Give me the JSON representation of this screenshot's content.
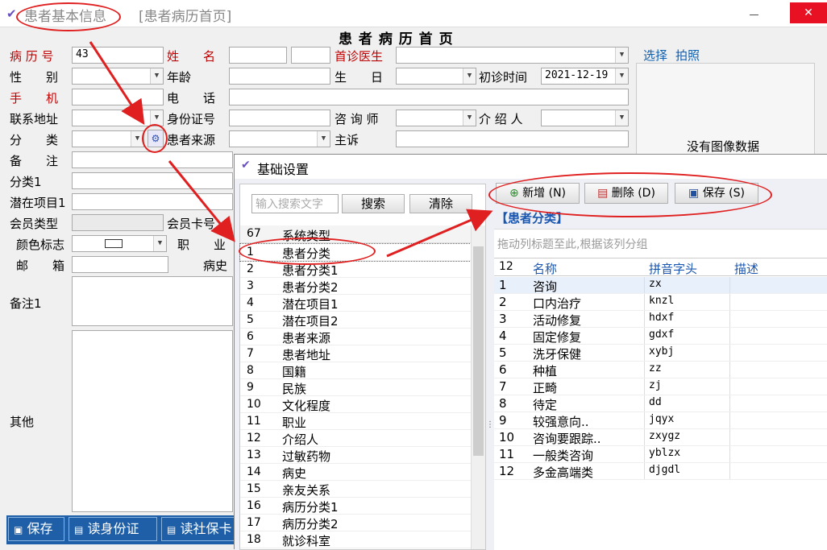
{
  "window": {
    "title": "患者基本信息",
    "tab2": "[患者病历首页]",
    "form_title": "患 者 病 历 首 页",
    "minimize": "－",
    "close": "✕"
  },
  "form": {
    "record_no_label": "病 历 号",
    "record_no": "43",
    "name_label": "姓　　名",
    "first_doctor_label": "首诊医生",
    "gender_label": "性　　别",
    "age_label": "年龄",
    "birthday_label": "生　　日",
    "first_visit_label": "初诊时间",
    "first_visit": "2021-12-19",
    "mobile_label": "手　　机",
    "phone_label": "电　　话",
    "address_label": "联系地址",
    "id_label": "身份证号",
    "consultant_label": "咨 询 师",
    "referrer_label": "介 绍 人",
    "category_label": "分　　类",
    "source_label": "患者来源",
    "complaint_label": "主诉",
    "remark_label": "备　　注",
    "cat1_label": "分类1",
    "potential_label": "潜在项目1",
    "member_type_label": "会员类型",
    "member_card_label": "会员卡号",
    "color_label": "颜色标志",
    "job_label": "职　　业",
    "email_label": "邮　　箱",
    "history_label": "病史",
    "remark1_label": "备注1",
    "other_label": "其他"
  },
  "photo": {
    "select": "选择",
    "shoot": "拍照",
    "no_image": "没有图像数据"
  },
  "bottom": {
    "save": "保存",
    "read_id": "读身份证",
    "read_social": "读社保卡"
  },
  "dialog": {
    "title": "基础设置",
    "search_placeholder": "输入搜索文字",
    "search_btn": "搜索",
    "clear_btn": "清除",
    "list_count": "67",
    "list_header": "系统类型",
    "list": [
      {
        "no": "1",
        "name": "患者分类"
      },
      {
        "no": "2",
        "name": "患者分类1"
      },
      {
        "no": "3",
        "name": "患者分类2"
      },
      {
        "no": "4",
        "name": "潜在项目1"
      },
      {
        "no": "5",
        "name": "潜在项目2"
      },
      {
        "no": "6",
        "name": "患者来源"
      },
      {
        "no": "7",
        "name": "患者地址"
      },
      {
        "no": "8",
        "name": "国籍"
      },
      {
        "no": "9",
        "name": "民族"
      },
      {
        "no": "10",
        "name": "文化程度"
      },
      {
        "no": "11",
        "name": "职业"
      },
      {
        "no": "12",
        "name": "介绍人"
      },
      {
        "no": "13",
        "name": "过敏药物"
      },
      {
        "no": "14",
        "name": "病史"
      },
      {
        "no": "15",
        "name": "亲友关系"
      },
      {
        "no": "16",
        "name": "病历分类1"
      },
      {
        "no": "17",
        "name": "病历分类2"
      },
      {
        "no": "18",
        "name": "就诊科室"
      }
    ],
    "add_btn": "新增 (N)",
    "delete_btn": "删除 (D)",
    "save_btn": "保存 (S)",
    "section": "【患者分类】",
    "group_hint": "拖动列标题至此,根据该列分组",
    "grid_count": "12",
    "col_name": "名称",
    "col_pinyin": "拼音字头",
    "col_desc": "描述",
    "rows": [
      {
        "no": "1",
        "name": "咨询",
        "py": "zx"
      },
      {
        "no": "2",
        "name": "口内治疗",
        "py": "knzl"
      },
      {
        "no": "3",
        "name": "活动修复",
        "py": "hdxf"
      },
      {
        "no": "4",
        "name": "固定修复",
        "py": "gdxf"
      },
      {
        "no": "5",
        "name": "洗牙保健",
        "py": "xybj"
      },
      {
        "no": "6",
        "name": "种植",
        "py": "zz"
      },
      {
        "no": "7",
        "name": "正畸",
        "py": "zj"
      },
      {
        "no": "8",
        "name": "待定",
        "py": "dd"
      },
      {
        "no": "9",
        "name": "较强意向..",
        "py": "jqyx"
      },
      {
        "no": "10",
        "name": "咨询要跟踪..",
        "py": "zxygz"
      },
      {
        "no": "11",
        "name": "一般类咨询",
        "py": "yblzx"
      },
      {
        "no": "12",
        "name": "多金高端类",
        "py": "djgdl"
      }
    ]
  }
}
